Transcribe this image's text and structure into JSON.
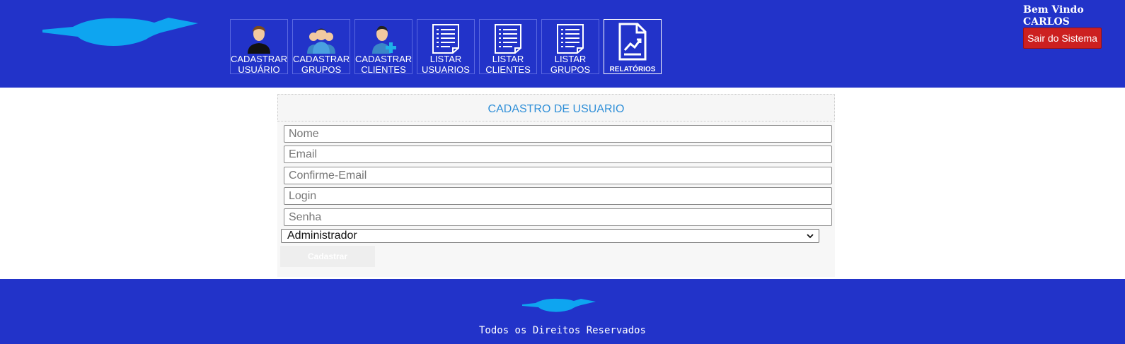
{
  "header": {
    "welcome_label": "Bem Vindo",
    "user_name": "CARLOS",
    "logout_label": "Sair do Sistema",
    "logo_icon": "cloud-logo-icon"
  },
  "nav": [
    {
      "line1": "CADASTRAR",
      "line2": "USUÁRIO",
      "icon": "user-icon"
    },
    {
      "line1": "CADASTRAR",
      "line2": "GRUPOS",
      "icon": "group-icon"
    },
    {
      "line1": "CADASTRAR",
      "line2": "CLIENTES",
      "icon": "add-client-icon"
    },
    {
      "line1": "LISTAR",
      "line2": "USUARIOS",
      "icon": "list-document-icon"
    },
    {
      "line1": "LISTAR",
      "line2": "CLIENTES",
      "icon": "list-document-icon"
    },
    {
      "line1": "LISTAR",
      "line2": "GRUPOS",
      "icon": "list-document-icon"
    },
    {
      "line1": "RELATÓRIOS",
      "line2": "",
      "icon": "report-chart-icon"
    }
  ],
  "form": {
    "title": "CADASTRO DE USUARIO",
    "fields": [
      {
        "placeholder": "Nome",
        "value": ""
      },
      {
        "placeholder": "Email",
        "value": ""
      },
      {
        "placeholder": "Confirme-Email",
        "value": ""
      },
      {
        "placeholder": "Login",
        "value": ""
      },
      {
        "placeholder": "Senha",
        "value": ""
      }
    ],
    "role_selected": "Administrador",
    "submit_label": "Cadastrar"
  },
  "footer": {
    "text": "Todos os Direitos Reservados"
  },
  "colors": {
    "brand_blue": "#2233c9",
    "logo_cyan": "#0ea5f0",
    "logout_red": "#cc2020",
    "title_blue": "#2f8fd8"
  }
}
